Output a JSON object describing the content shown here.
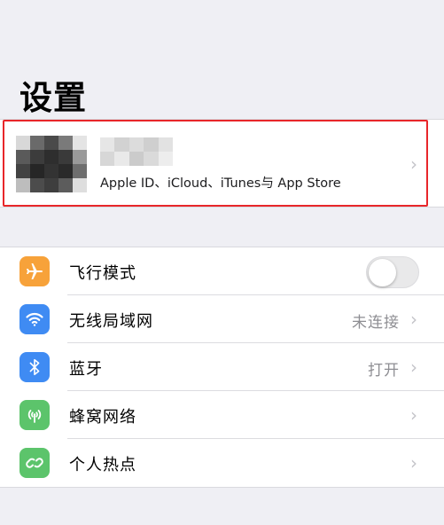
{
  "title": "设置",
  "profile": {
    "subtitle": "Apple ID、iCloud、iTunes与 App Store",
    "chevron": "›"
  },
  "colors": {
    "highlight": "#e8262a",
    "airplane": "#f7a23a",
    "wifi": "#3f8bf3",
    "bluetooth": "#3f8bf3",
    "cellular": "#5cc46b",
    "hotspot": "#5cc46b"
  },
  "settings": [
    {
      "label": "飞行模式",
      "icon": "airplane-icon",
      "toggle": "off"
    },
    {
      "label": "无线局域网",
      "icon": "wifi-icon",
      "value": "未连接",
      "chevron": "›"
    },
    {
      "label": "蓝牙",
      "icon": "bluetooth-icon",
      "value": "打开",
      "chevron": "›"
    },
    {
      "label": "蜂窝网络",
      "icon": "cellular-icon",
      "chevron": "›"
    },
    {
      "label": "个人热点",
      "icon": "hotspot-icon",
      "chevron": "›"
    }
  ]
}
